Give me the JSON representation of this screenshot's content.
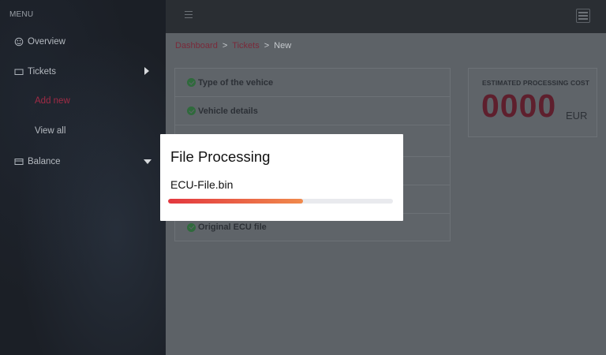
{
  "sidebar": {
    "menu_title": "MENU",
    "items": [
      {
        "label": "Overview",
        "icon": "palette-icon"
      },
      {
        "label": "Tickets",
        "icon": "ticket-icon",
        "caret": "caret-right-icon"
      },
      {
        "label": "Balance",
        "icon": "wallet-icon",
        "caret": "caret-down-icon"
      }
    ],
    "subitems": [
      {
        "label": "Add new",
        "active": true
      },
      {
        "label": "View all",
        "active": false
      }
    ]
  },
  "topbar": {
    "menu_icon": "hamburger-icon",
    "right_icon": "list-panel-icon"
  },
  "breadcrumb": {
    "items": [
      "Dashboard",
      "Tickets",
      "New"
    ],
    "separator": ">"
  },
  "steps": [
    {
      "label": "Type of the vehice"
    },
    {
      "label": "Vehicle details"
    },
    {
      "label": ""
    },
    {
      "label": ""
    },
    {
      "label": ""
    },
    {
      "label": "Original ECU file"
    }
  ],
  "cost": {
    "title": "ESTIMATED PROCESSING COST",
    "value": "0000",
    "currency": "EUR"
  },
  "modal": {
    "title": "File Processing",
    "file_name": "ECU-File.bin",
    "progress_fraction": 0.6
  },
  "colors": {
    "accent": "#a12b46",
    "progress_start": "#e3373f",
    "progress_end": "#f08a4c"
  }
}
